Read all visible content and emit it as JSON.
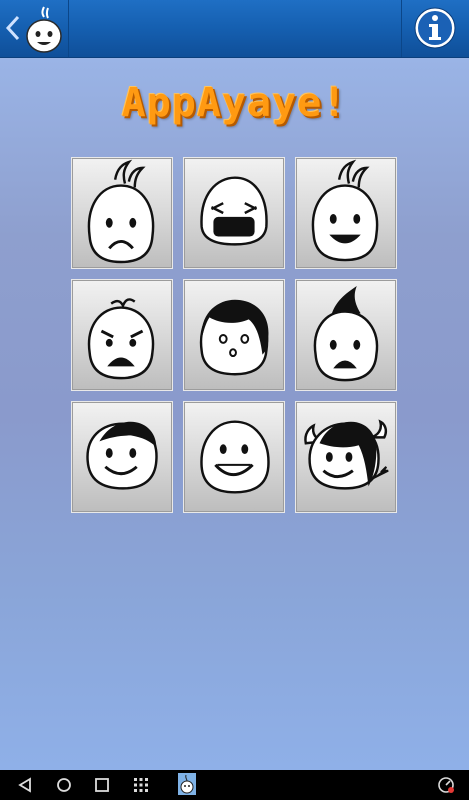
{
  "app": {
    "title": "AppAyaye!"
  },
  "toolbar": {
    "back_icon": "chevron-left-icon",
    "app_icon": "face-mascot-icon",
    "info_icon": "info-icon"
  },
  "faces": [
    {
      "id": "face-1",
      "kind": "spiky-hair-frown"
    },
    {
      "id": "face-2",
      "kind": "closed-eyes-yawn"
    },
    {
      "id": "face-3",
      "kind": "spiky-hair-smile"
    },
    {
      "id": "face-4",
      "kind": "angry-tuft"
    },
    {
      "id": "face-5",
      "kind": "bob-hair-surprised"
    },
    {
      "id": "face-6",
      "kind": "mohawk-sad"
    },
    {
      "id": "face-7",
      "kind": "side-hair-smile"
    },
    {
      "id": "face-8",
      "kind": "big-smile"
    },
    {
      "id": "face-9",
      "kind": "devil-horns-smile"
    }
  ],
  "colors": {
    "title_orange": "#ff9a12",
    "topbar_blue": "#1866b8",
    "background": "#8fa7d6"
  },
  "navbar": {
    "items": [
      "back-icon",
      "home-icon",
      "recents-icon",
      "apps-grid-icon"
    ]
  }
}
